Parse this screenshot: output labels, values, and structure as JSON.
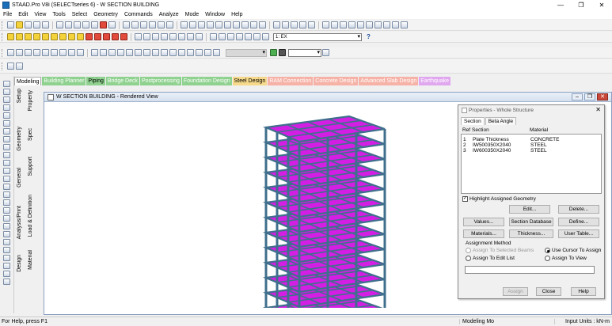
{
  "window": {
    "title": "STAAD.Pro V8i (SELECTseries 6) - W SECTION BUILDING"
  },
  "menu": [
    "File",
    "Edit",
    "View",
    "Tools",
    "Select",
    "Geometry",
    "Commands",
    "Analyze",
    "Mode",
    "Window",
    "Help"
  ],
  "toolbar": {
    "load_case": "1: EX"
  },
  "mode_tabs": [
    {
      "label": "Modeling",
      "color": "#ffffff"
    },
    {
      "label": "Building Planner",
      "color": "#8fd18f"
    },
    {
      "label": "Piping",
      "color": "#8fd18f"
    },
    {
      "label": "Bridge Deck",
      "color": "#8fd18f"
    },
    {
      "label": "Postprocessing",
      "color": "#8fd18f"
    },
    {
      "label": "Foundation Design",
      "color": "#8fd18f"
    },
    {
      "label": "Steel Design",
      "color": "#f6d98a"
    },
    {
      "label": "RAM Connection",
      "color": "#f6b2a6"
    },
    {
      "label": "Concrete Design",
      "color": "#f6b2a6"
    },
    {
      "label": "Advanced Slab Design",
      "color": "#f6b2a6"
    },
    {
      "label": "Earthquake",
      "color": "#e0a7ef"
    }
  ],
  "side_tabs": {
    "setup": "Setup",
    "geometry": "Geometry",
    "general": "General",
    "property": "Property",
    "spec": "Spec",
    "support": "Support",
    "load": "Load & Definition",
    "analysis": "Analysis/Print",
    "design": "Design",
    "material": "Material"
  },
  "viewport": {
    "title": "W SECTION BUILDING - Rendered View"
  },
  "properties": {
    "title": "Properties - Whole Structure",
    "tabs": [
      "Section",
      "Beta Angle"
    ],
    "headers": [
      "Ref",
      "Section",
      "Material"
    ],
    "rows": [
      {
        "ref": "1",
        "section": "Plate Thickness",
        "material": "CONCRETE"
      },
      {
        "ref": "2",
        "section": "IW500350X2040",
        "material": "STEEL"
      },
      {
        "ref": "3",
        "section": "IW600350X2040",
        "material": "STEEL"
      }
    ],
    "highlight_label": "Highlight Assigned Geometry",
    "buttons": {
      "edit": "Edit...",
      "delete": "Delete...",
      "values": "Values...",
      "section_db": "Section Database",
      "define": "Define...",
      "materials": "Materials...",
      "thickness": "Thickness...",
      "user_table": "User Table...",
      "assign": "Assign",
      "close": "Close",
      "help": "Help"
    },
    "assignment_method": "Assignment Method",
    "radios": {
      "selected_beams": "Assign To Selected Beams",
      "use_cursor": "Use Cursor To Assign",
      "edit_list": "Assign To Edit List",
      "assign_view": "Assign To View"
    }
  },
  "status": {
    "help": "For Help, press F1",
    "mode": "Modeling Mo",
    "units": "Input Units : kN-m"
  },
  "colors": {
    "slab": "#d21fe3",
    "beam": "#3f6f8c"
  }
}
